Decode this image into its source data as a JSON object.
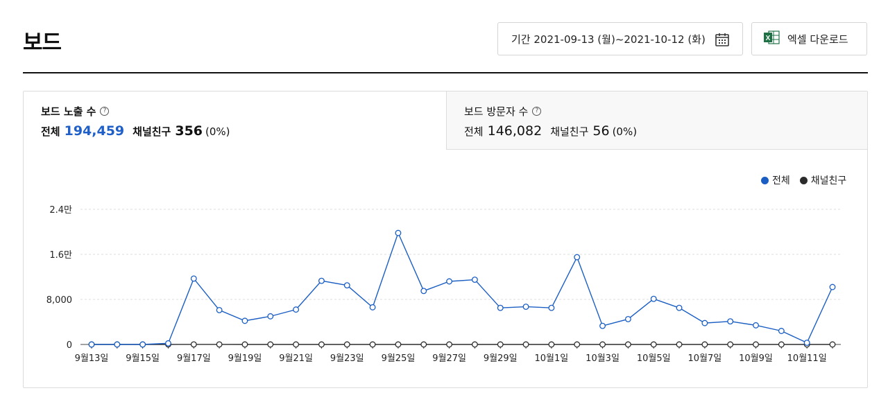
{
  "header": {
    "title": "보드",
    "date_range_label": "기간 2021-09-13 (월)~2021-10-12 (화)",
    "excel_label": "엑셀 다운로드",
    "excel_icon": "X"
  },
  "tabs": [
    {
      "title": "보드 노출 수",
      "help": "?",
      "total_label": "전체",
      "total_value": "194,459",
      "friend_label": "채널친구",
      "friend_value": "356",
      "friend_pct": "(0%)"
    },
    {
      "title": "보드 방문자 수",
      "help": "?",
      "total_label": "전체",
      "total_value": "146,082",
      "friend_label": "채널친구",
      "friend_value": "56",
      "friend_pct": "(0%)"
    }
  ],
  "colors": {
    "total": "#1a5ec4",
    "friends": "#2b2b2b",
    "accent_text": "#1f5fc8"
  },
  "chart_data": {
    "type": "line",
    "x": [
      "9월13일",
      "9월14일",
      "9월15일",
      "9월16일",
      "9월17일",
      "9월18일",
      "9월19일",
      "9월20일",
      "9월21일",
      "9월22일",
      "9월23일",
      "9월24일",
      "9월25일",
      "9월26일",
      "9월27일",
      "9월28일",
      "9월29일",
      "9월30일",
      "10월1일",
      "10월2일",
      "10월3일",
      "10월4일",
      "10월5일",
      "10월6일",
      "10월7일",
      "10월8일",
      "10월9일",
      "10월10일",
      "10월11일",
      "10월12일"
    ],
    "tick_labels": [
      "9월13일",
      "9월15일",
      "9월17일",
      "9월19일",
      "9월21일",
      "9월23일",
      "9월25일",
      "9월27일",
      "9월29일",
      "10월1일",
      "10월3일",
      "10월5일",
      "10월7일",
      "10월9일",
      "10월11일"
    ],
    "y_ticks": [
      "0",
      "8,000",
      "1.6만",
      "2.4만"
    ],
    "y_tick_values": [
      0,
      8000,
      16000,
      24000
    ],
    "ylim": [
      0,
      24000
    ],
    "grid": true,
    "legend_position": "top-right",
    "series": [
      {
        "name": "전체",
        "values": [
          0,
          0,
          0,
          200,
          11700,
          6100,
          4200,
          5000,
          6200,
          11300,
          10500,
          6600,
          19800,
          9500,
          11200,
          11500,
          6500,
          6700,
          6500,
          15500,
          3300,
          4500,
          8100,
          6500,
          3800,
          4100,
          3400,
          2400,
          300,
          10200
        ]
      },
      {
        "name": "채널친구",
        "values": [
          0,
          0,
          0,
          0,
          10,
          10,
          0,
          0,
          0,
          0,
          0,
          0,
          0,
          0,
          0,
          0,
          0,
          0,
          0,
          0,
          0,
          0,
          0,
          0,
          0,
          0,
          0,
          0,
          0,
          0
        ]
      }
    ]
  }
}
